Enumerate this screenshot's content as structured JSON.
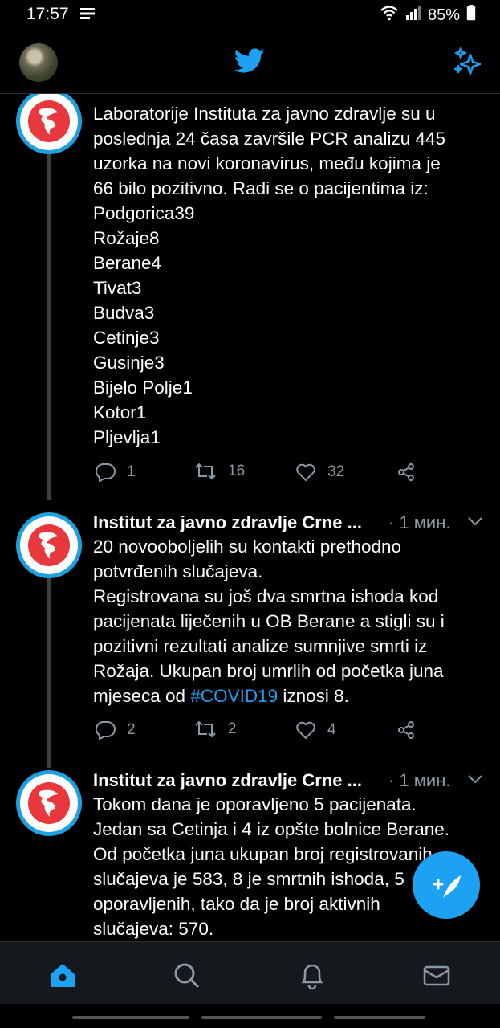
{
  "status_bar": {
    "time": "17:57",
    "battery": "85%",
    "icons": [
      "notification-icon",
      "wifi-icon",
      "signal-icon",
      "battery-icon"
    ]
  },
  "header": {
    "logo": "twitter-bird-icon",
    "right_icon": "sparkle-icon"
  },
  "tweets": [
    {
      "lines": [
        "Laboratorije Instituta za javno zdravlje su u",
        "poslednja 24 časa završile PCR analizu 445",
        "uzorka na novi koronavirus, među kojima je",
        "66 bilo pozitivno. Radi se o pacijentima iz:",
        "Podgorica39",
        "Rožaje8",
        "Berane4",
        "Tivat3",
        "Budva3",
        "Cetinje3",
        "Gusinje3",
        "Bijelo Polje1",
        "Kotor1",
        "Pljevlja1"
      ],
      "replies": "1",
      "retweets": "16",
      "likes": "32"
    },
    {
      "name": "Institut za javno zdravlje Crne ...",
      "time": "· 1 мин.",
      "lines": [
        "20 novooboljelih su kontakti prethodno",
        "potvrđenih slučajeva.",
        "Registrovana su još dva smrtna ishoda kod",
        "pacijenata liječenih u OB Berane a stigli su i",
        "pozitivni rezultati analize sumnjive smrti iz",
        "Rožaja. Ukupan broj umrlih od početka juna"
      ],
      "last_line_pre": "mjeseca od ",
      "hashtag": "#COVID19",
      "last_line_post": " iznosi 8.",
      "replies": "2",
      "retweets": "2",
      "likes": "4"
    },
    {
      "name": "Institut za javno zdravlje Crne ...",
      "time": "· 1 мин.",
      "lines": [
        "Tokom dana je oporavljeno 5 pacijenata.",
        "Jedan sa Cetinja i 4 iz opšte bolnice Berane.",
        "Od početka juna ukupan broj registrovanih",
        "slučajeva je 583, 8 je smrtnih ishoda, 5",
        "oporavljenih, tako da je broj aktivnih",
        "slučajeva: 570."
      ]
    }
  ],
  "nav": [
    "home-icon",
    "search-icon",
    "notifications-icon",
    "messages-icon"
  ],
  "colors": {
    "accent": "#1da1f2",
    "background": "#000000",
    "muted": "#8b98a5"
  }
}
